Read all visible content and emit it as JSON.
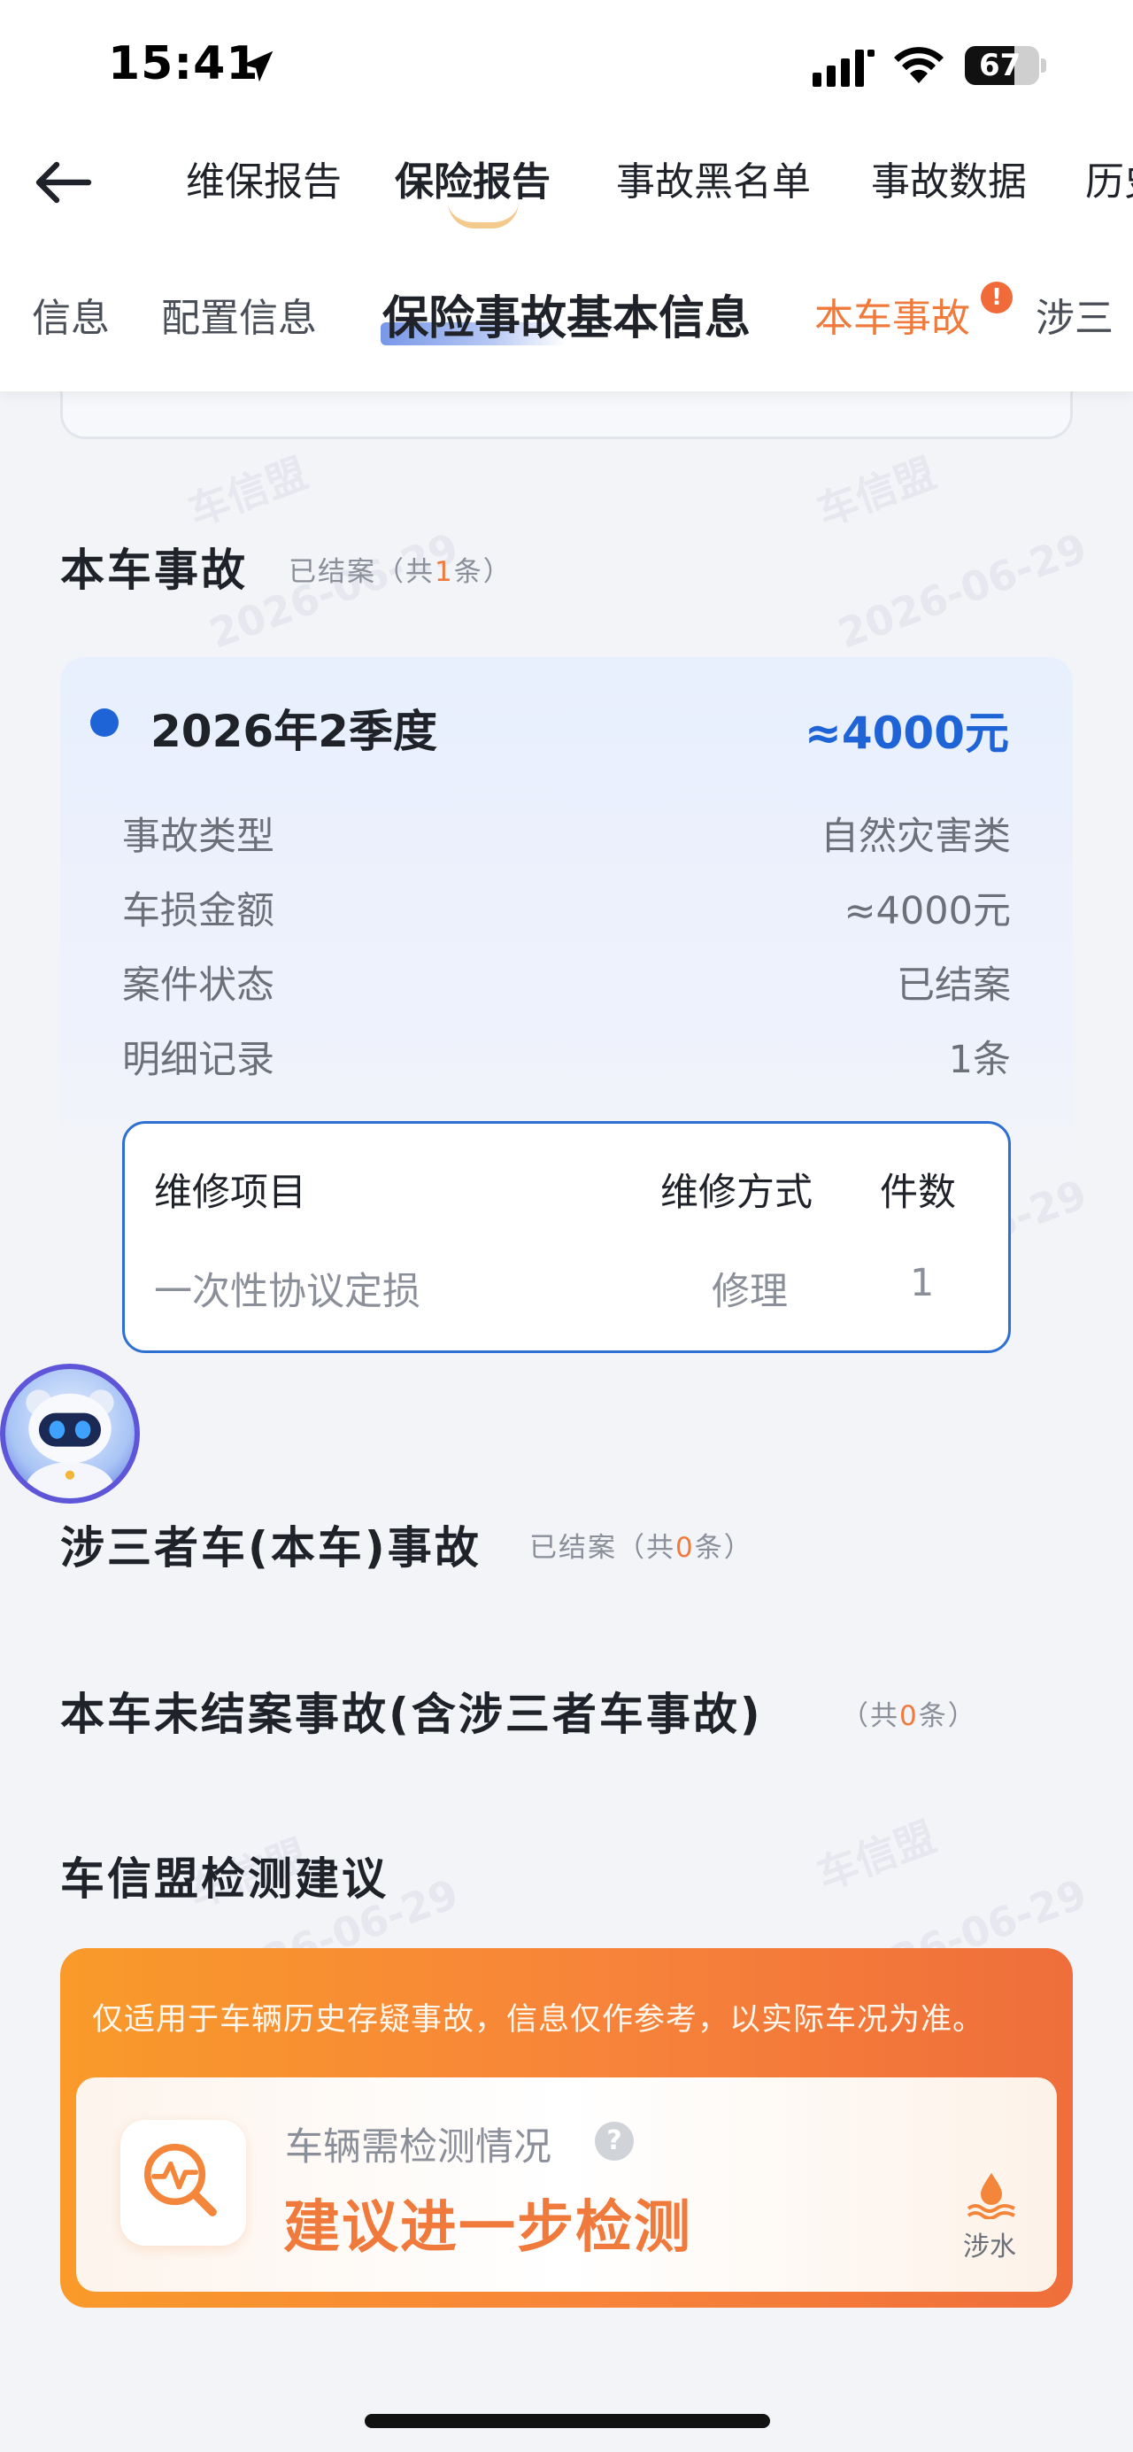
{
  "status_bar": {
    "time": "15:41",
    "battery": "67",
    "battery_level": 0.67
  },
  "nav": {
    "tabs": [
      {
        "label": "维保报告"
      },
      {
        "label": "保险报告"
      },
      {
        "label": "事故黑名单"
      },
      {
        "label": "事故数据"
      },
      {
        "label": "历史"
      }
    ],
    "active_tab": "保险报告"
  },
  "subnav": {
    "tabs": [
      {
        "label": "信息"
      },
      {
        "label": "配置信息"
      },
      {
        "label": "保险事故基本信息"
      },
      {
        "label": "本车事故",
        "alert": "!"
      },
      {
        "label": "涉三"
      }
    ],
    "active_tab": "保险事故基本信息"
  },
  "own_accidents": {
    "title": "本车事故",
    "status_prefix": "已结案（共",
    "count": "1",
    "status_suffix": "条）",
    "record": {
      "quarter": "2026年2季度",
      "amount": "≈4000元",
      "rows": [
        {
          "label": "事故类型",
          "value": "自然灾害类"
        },
        {
          "label": "车损金额",
          "value": "≈4000元"
        },
        {
          "label": "案件状态",
          "value": "已结案"
        },
        {
          "label": "明细记录",
          "value": "1条"
        }
      ],
      "repair_table": {
        "headers": [
          "维修项目",
          "维修方式",
          "件数"
        ],
        "rows": [
          [
            "一次性协议定损",
            "修理",
            "1"
          ]
        ]
      }
    }
  },
  "third_party": {
    "title": "涉三者车(本车)事故",
    "status_prefix": "已结案（共",
    "count": "0",
    "status_suffix": "条）"
  },
  "unsettled": {
    "title": "本车未结案事故(含涉三者车事故)",
    "status_prefix": "（共",
    "count": "0",
    "status_suffix": "条）"
  },
  "suggestion": {
    "title": "车信盟检测建议",
    "note": "仅适用于车辆历史存疑事故，信息仅作参考，以实际车况为准。",
    "sub_label": "车辆需检测情况",
    "main_text": "建议进一步检测",
    "tag_label": "涉水",
    "help": "?"
  },
  "watermark": {
    "brand": "车信盟",
    "date": "2026-06-29"
  },
  "colors": {
    "accent_blue": "#1f64d6",
    "accent_orange": "#f07a3c",
    "card_orange": "#f7833a"
  }
}
